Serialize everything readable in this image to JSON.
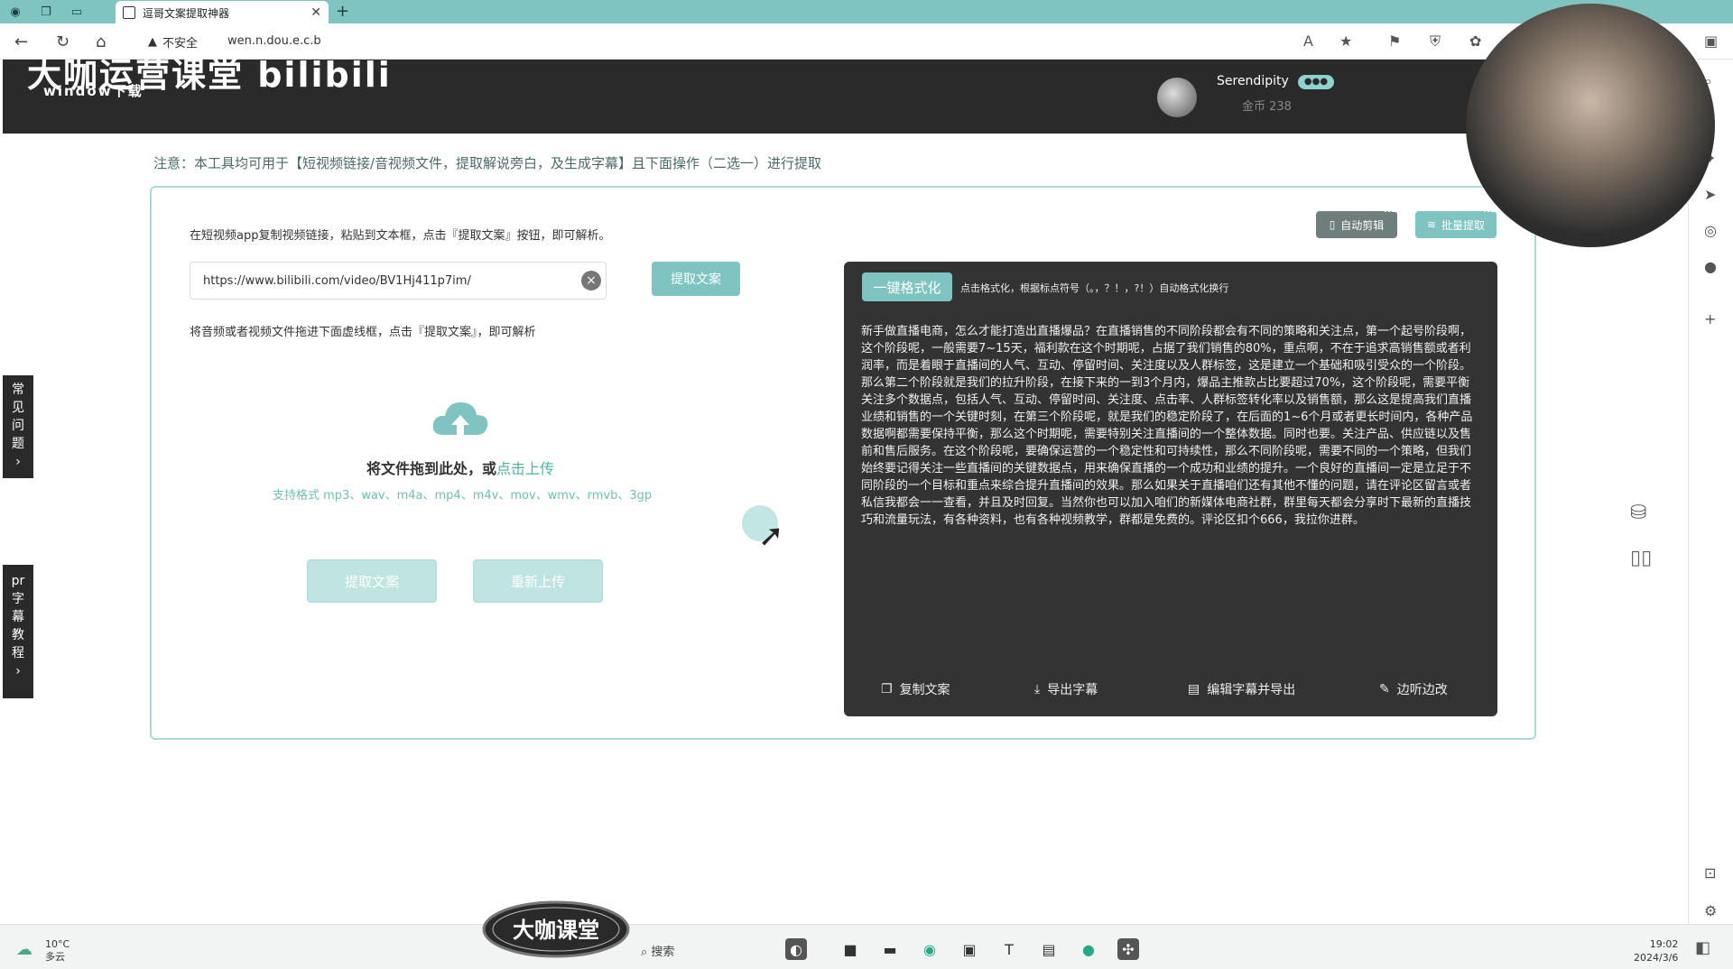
{
  "browser": {
    "tab_title": "逗哥文案提取神器",
    "security_label": "不安全",
    "url": "wen.n.dou.e.c.b"
  },
  "header": {
    "brand": "大咖运营课堂 bilibili",
    "brand_sub": "window下载",
    "username": "Serendipity",
    "coins": "金币 238"
  },
  "notice": "注意：本工具均可用于【短视频链接/音视频文件，提取解说旁白，及生成字幕】且下面操作（二选一）进行提取",
  "left_panel": {
    "instruction_link": "在短视频app复制视频链接，粘贴到文本框，点击『提取文案』按钮，即可解析。",
    "url_value": "https://www.bilibili.com/video/BV1Hj411p7im/",
    "extract_label": "提取文案",
    "instruction_file": "将音频或者视频文件拖进下面虚线框，点击『提取文案』，即可解析",
    "drop_text": "将文件拖到此处，或",
    "upload_link": "点击上传",
    "formats": "支持格式 mp3、wav、m4a、mp4、m4v、mov、wmv、rmvb、3gp",
    "extract_button": "提取文案",
    "reupload_button": "重新上传"
  },
  "top_buttons": {
    "auto_clip": "自动剪辑",
    "batch": "批量提取",
    "new_tag": "NEW"
  },
  "result": {
    "format_button": "一键格式化",
    "format_hint": "点击格式化，根据标点符号（。，？！，?！）自动格式化换行",
    "text": "新手做直播电商，怎么才能打造出直播爆品？在直播销售的不同阶段都会有不同的策略和关注点，第一个起号阶段啊，这个阶段呢，一般需要7~15天，福利款在这个时期呢，占据了我们销售的80%，重点啊，不在于追求高销售额或者利润率，而是着眼于直播间的人气、互动、停留时间、关注度以及人群标签，这是建立一个基础和吸引受众的一个阶段。那么第二个阶段就是我们的拉升阶段，在接下来的一到3个月内，爆品主推款占比要超过70%，这个阶段呢，需要平衡关注多个数据点，包括人气、互动、停留时间、关注度、点击率、人群标签转化率以及销售额，那么这是提高我们直播业绩和销售的一个关键时刻，在第三个阶段呢，就是我们的稳定阶段了，在后面的1~6个月或者更长时间内，各种产品数据啊都需要保持平衡，那么这个时期呢，需要特别关注直播间的一个整体数据。同时也要。关注产品、供应链以及售前和售后服务。在这个阶段呢，要确保运营的一个稳定性和可持续性，那么不同阶段呢，需要不同的一个策略，但我们始终要记得关注一些直播间的关键数据点，用来确保直播的一个成功和业绩的提升。一个良好的直播间一定是立足于不同阶段的一个目标和重点来综合提升直播间的效果。那么如果关于直播咱们还有其他不懂的问题，请在评论区留言或者私信我都会一一查看，并且及时回复。当然你也可以加入咱们的新媒体电商社群，群里每天都会分享时下最新的直播技巧和流量玩法，有各种资料，也有各种视频教学，群都是免费的。评论区扣个666，我拉你进群。",
    "actions": [
      "复制文案",
      "导出字幕",
      "编辑字幕并导出",
      "边听边改"
    ]
  },
  "side_tabs": {
    "faq": [
      "常",
      "见",
      "问",
      "题",
      "›"
    ],
    "pr": [
      "pr",
      "字",
      "幕",
      "教",
      "程",
      "›"
    ]
  },
  "taskbar": {
    "temp": "10°C",
    "weather": "多云",
    "logo": "大咖课堂",
    "search": "搜索",
    "time": "19:02",
    "date": "2024/3/6"
  },
  "colors": {
    "accent": "#7fc4c0",
    "dark": "#2a2a2a",
    "panel": "#333333"
  }
}
